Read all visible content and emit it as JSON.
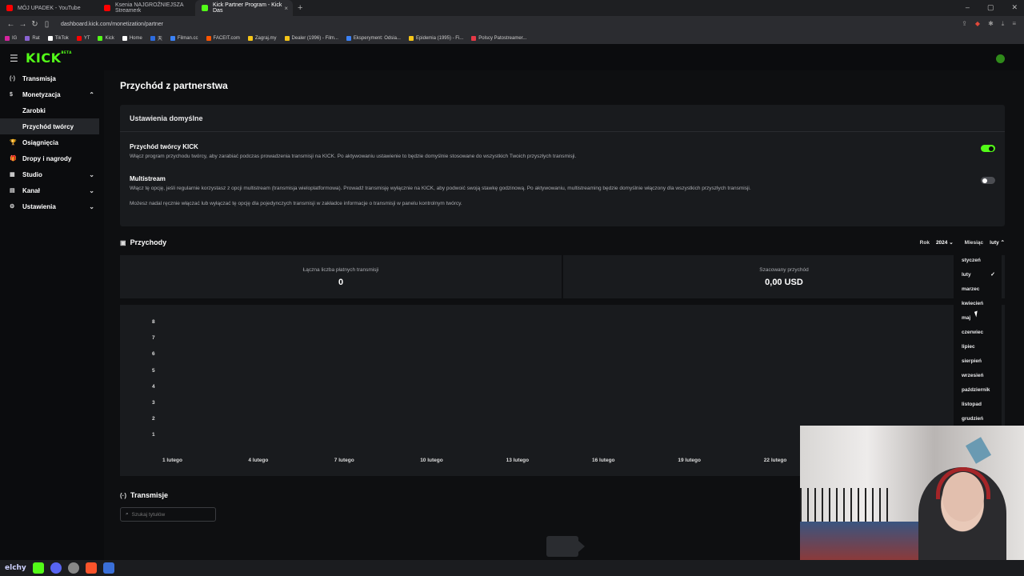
{
  "browser": {
    "tabs": [
      {
        "label": "MÓJ UPADEK - YouTube",
        "color": "#ff0000"
      },
      {
        "label": "Ksenia NAJGROŹNIEJSZA Streamerk",
        "color": "#ff0000"
      },
      {
        "label": "Kick Partner Program - Kick Das",
        "color": "#53fc18",
        "close": "×"
      }
    ],
    "new_tab": "+",
    "url": "dashboard.kick.com/monetization/partner",
    "bookmarks": [
      {
        "label": "IG",
        "color": "#d6249f"
      },
      {
        "label": "Rat",
        "color": "#8a63d2"
      },
      {
        "label": "TikTok",
        "color": "#ffffff"
      },
      {
        "label": "YT",
        "color": "#ff0000"
      },
      {
        "label": "Kick",
        "color": "#53fc18"
      },
      {
        "label": "Home",
        "color": "#ffffff"
      },
      {
        "label": "天",
        "color": "#2d6cdf"
      },
      {
        "label": "Filman.cc",
        "color": "#3b82f6"
      },
      {
        "label": "FACEIT.com",
        "color": "#ff5500"
      },
      {
        "label": "Zagraj.my",
        "color": "#f5c518"
      },
      {
        "label": "Dealer (1996) - Film...",
        "color": "#f5c518"
      },
      {
        "label": "Eksperyment: Odsia...",
        "color": "#3b82f6"
      },
      {
        "label": "Epidemia (1995) - Fi...",
        "color": "#f5c518"
      },
      {
        "label": "Polscy Patostreamer...",
        "color": "#e63946"
      }
    ]
  },
  "app": {
    "logo": "KICK",
    "logo_badge": "BETA"
  },
  "sidebar": {
    "items": [
      {
        "label": "Transmisja",
        "icon": "(·)"
      },
      {
        "label": "Monetyzacja",
        "icon": "$",
        "chevron": "⌃"
      },
      {
        "label": "Zarobki"
      },
      {
        "label": "Przychód twórcy"
      },
      {
        "label": "Osiągnięcia",
        "icon": "🏆"
      },
      {
        "label": "Dropy i nagrody",
        "icon": "🎁"
      },
      {
        "label": "Studio",
        "icon": "▦",
        "chevron": "⌄"
      },
      {
        "label": "Kanał",
        "icon": "▤",
        "chevron": "⌄"
      },
      {
        "label": "Ustawienia",
        "icon": "⚙",
        "chevron": "⌄"
      }
    ]
  },
  "page": {
    "title": "Przychód z partnerstwa",
    "defaults": {
      "heading": "Ustawienia domyślne",
      "option1": {
        "title": "Przychód twórcy KICK",
        "desc": "Włącz program przychodu twórcy, aby zarabiać podczas prowadzenia transmisji na KICK. Po aktywowaniu ustawienie to będzie domyślnie stosowane do wszystkich Twoich przyszłych transmisji.",
        "enabled": true
      },
      "option2": {
        "title": "Multistream",
        "desc": "Włącz tę opcję, jeśli regularnie korzystasz z opcji multistream (transmisja wieloplatformowa). Prowadź transmisję wyłącznie na KICK, aby podwoić swoją stawkę godzinową. Po aktywowaniu, multistreaming będzie domyślnie włączony dla wszystkich przyszłych transmisji.",
        "note": "Możesz nadal ręcznie włączać lub wyłączać tę opcję dla pojedynczych transmisji w zakładce informacje o transmisji w panelu kontrolnym twórcy.",
        "enabled": false
      }
    },
    "revenue": {
      "heading": "Przychody",
      "year_label": "Rok",
      "year_value": "2024",
      "month_label": "Miesiąc",
      "month_value": "luty",
      "stats": [
        {
          "label": "Łączna liczba płatnych transmisji",
          "value": "0"
        },
        {
          "label": "Szacowany przychód",
          "value": "0,00 USD"
        }
      ]
    },
    "streams": {
      "heading": "Transmisje",
      "search_placeholder": "Szukaj tytułów"
    }
  },
  "chart_data": {
    "type": "bar",
    "categories": [
      "1 lutego",
      "4 lutego",
      "7 lutego",
      "10 lutego",
      "13 lutego",
      "16 lutego",
      "19 lutego",
      "22 lutego"
    ],
    "y_ticks": [
      "8",
      "7",
      "6",
      "5",
      "4",
      "3",
      "2",
      "1"
    ],
    "values": [
      0,
      0,
      0,
      0,
      0,
      0,
      0,
      0
    ],
    "ylim": [
      1,
      8
    ]
  },
  "month_dropdown": {
    "options": [
      "styczeń",
      "luty",
      "marzec",
      "kwiecień",
      "maj",
      "czerwiec",
      "lipiec",
      "sierpień",
      "wrzesień",
      "październik",
      "listopad",
      "grudzień"
    ],
    "selected": "luty"
  },
  "colors": {
    "accent": "#53fc18",
    "card": "#191b1e",
    "background": "#0e0f11"
  }
}
